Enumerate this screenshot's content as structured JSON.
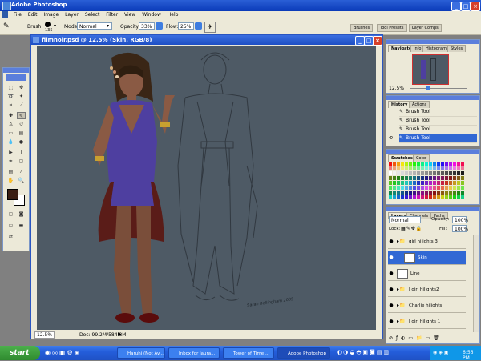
{
  "window": {
    "title": "Adobe Photoshop",
    "min": "_",
    "max": "□",
    "close": "×"
  },
  "menu": [
    "File",
    "Edit",
    "Image",
    "Layer",
    "Select",
    "Filter",
    "View",
    "Window",
    "Help"
  ],
  "options": {
    "brush_label": "Brush:",
    "brush_size": "135",
    "mode_label": "Mode:",
    "mode_value": "Normal",
    "opacity_label": "Opacity:",
    "opacity_value": "33%",
    "flow_label": "Flow:",
    "flow_value": "25%"
  },
  "well_tabs": [
    "Brushes",
    "Tool Presets",
    "Layer Comps"
  ],
  "document": {
    "title": "filmnoir.psd @ 12.5% (Skin, RGB/8)",
    "zoom": "12.5%",
    "doc_info": "Doc: 99.2M/584.8M",
    "signature": "Sarah Bellingham 2005"
  },
  "navigator": {
    "tabs": [
      "Navigator",
      "Info",
      "Histogram",
      "Styles"
    ],
    "zoom": "12.5%"
  },
  "history": {
    "tabs": [
      "History",
      "Actions"
    ],
    "items": [
      "Brush Tool",
      "Brush Tool",
      "Brush Tool",
      "Brush Tool"
    ],
    "selected_index": 3
  },
  "swatches": {
    "tabs": [
      "Swatches",
      "Color"
    ]
  },
  "layers": {
    "tabs": [
      "Layers",
      "Channels",
      "Paths"
    ],
    "blend_mode": "Normal",
    "opacity_label": "Opacity:",
    "opacity_value": "100%",
    "lock_label": "Lock:",
    "fill_label": "Fill:",
    "fill_value": "100%",
    "items": [
      {
        "name": "girl hilights 3",
        "kind": "group",
        "indent": false,
        "selected": false
      },
      {
        "name": "Skin",
        "kind": "layer",
        "indent": true,
        "selected": true
      },
      {
        "name": "Line",
        "kind": "layer",
        "indent": false,
        "selected": false
      },
      {
        "name": "J girl hilights2",
        "kind": "group",
        "indent": false,
        "selected": false
      },
      {
        "name": "Charlie hilights",
        "kind": "group",
        "indent": false,
        "selected": false
      },
      {
        "name": "J girl hilights 1",
        "kind": "group",
        "indent": false,
        "selected": false
      }
    ]
  },
  "taskbar": {
    "start": "start",
    "tasks": [
      "Haruhi (Not Av...",
      "Inbox for laura...",
      "Tower of Time ...",
      "Adobe Photoshop"
    ],
    "active_index": 3,
    "clock": "6:56 PM"
  },
  "colors": {
    "accent": "#3168d4",
    "foreground_color": "#3a1e12",
    "background_color": "#ffffff"
  }
}
